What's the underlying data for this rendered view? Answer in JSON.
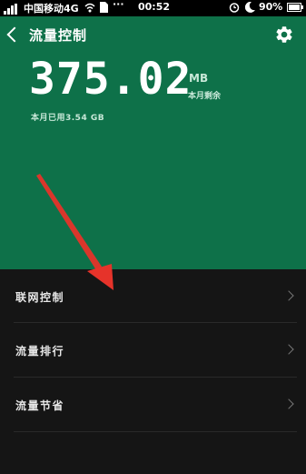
{
  "status_bar": {
    "carrier": "中国移动4G",
    "time": "00:52",
    "battery": "90%"
  },
  "header": {
    "title": "流量控制"
  },
  "usage": {
    "remaining_value": "375.02",
    "remaining_unit": "MB",
    "remaining_label": "本月剩余",
    "used_text": "本月已用3.54 GB"
  },
  "menu": {
    "items": [
      {
        "label": "联网控制"
      },
      {
        "label": "流量排行"
      },
      {
        "label": "流量节省"
      }
    ]
  },
  "colors": {
    "header_green": "#0e7149",
    "background": "#151515",
    "annotation_arrow": "#e6332a"
  }
}
